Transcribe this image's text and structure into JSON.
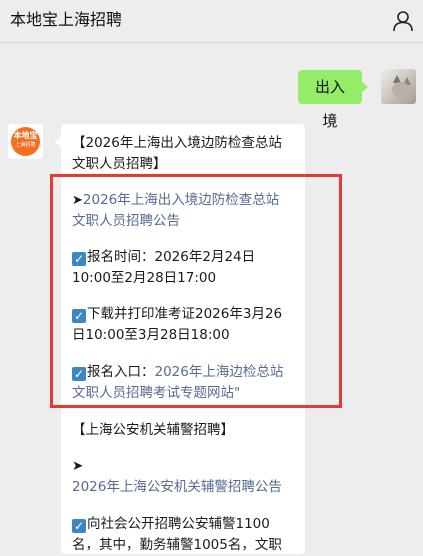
{
  "header": {
    "title": "本地宝上海招聘",
    "user_icon": "user-icon"
  },
  "chat": {
    "outgoing": {
      "text": "出入境",
      "avatar": "cat-photo"
    },
    "incoming": {
      "avatar_text": "本地宝",
      "avatar_subtext": "上海招聘",
      "section1_title_l1": "【2026年上海出入境边防检查总站",
      "section1_title_l2": "文职人员招聘】",
      "arrow1": "➤",
      "announce1_l1": "2026年上海出入境边防检查总站",
      "announce1_l2": "文职人员招聘公告",
      "reg_time_l1": "报名时间：2026年2月24日",
      "reg_time_l2": "10:00至2月28日17:00",
      "ticket_l1": "下载并打印准考证2026年3月26",
      "ticket_l2": "日10:00至3月28日18:00",
      "entry_label": "报名入口：",
      "entry_link_l1": "2026年上海边检总站",
      "entry_link_l2": "文职人员招聘考试专题网站\"",
      "section2_title": "【上海公安机关辅警招聘】",
      "arrow2": "➤",
      "announce2": "2026年上海公安机关辅警招聘公告",
      "recruit_l1": "向社会公开招聘公安辅警1100",
      "recruit_l2": "名，其中，勤务辅警1005名，文职"
    }
  }
}
